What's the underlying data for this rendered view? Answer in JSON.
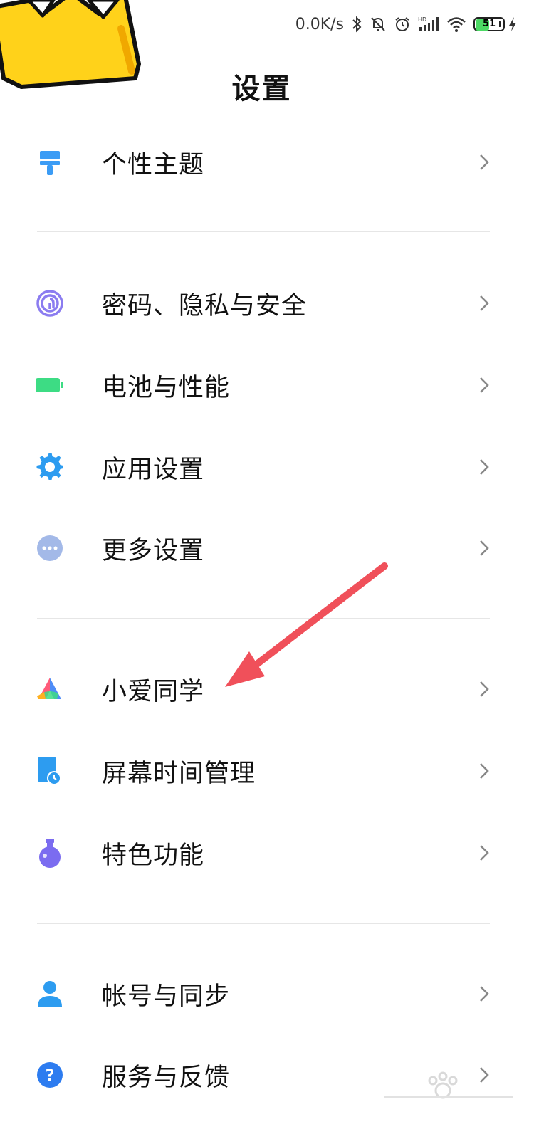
{
  "status_bar": {
    "net_speed": "0.0K/s",
    "battery_level": "51",
    "icons": [
      "bluetooth-icon",
      "mute-icon",
      "alarm-icon",
      "hd-signal-icon",
      "wifi-icon",
      "battery-icon",
      "charging-icon"
    ]
  },
  "header": {
    "title": "设置"
  },
  "settings": {
    "items": [
      {
        "label": "个性主题",
        "icon": "theme-brush-icon",
        "color": "#3b9cf5"
      },
      {
        "label": "密码、隐私与安全",
        "icon": "fingerprint-icon",
        "color": "#8b7cf0"
      },
      {
        "label": "电池与性能",
        "icon": "battery-icon",
        "color": "#3ddc84"
      },
      {
        "label": "应用设置",
        "icon": "gear-icon",
        "color": "#2d9cf0"
      },
      {
        "label": "更多设置",
        "icon": "more-dots-icon",
        "color": "#a3b9e8"
      },
      {
        "label": "小爱同学",
        "icon": "xiaoai-icon",
        "color": "#ff5b7a"
      },
      {
        "label": "屏幕时间管理",
        "icon": "screen-time-icon",
        "color": "#2d9cf0"
      },
      {
        "label": "特色功能",
        "icon": "flask-icon",
        "color": "#7b6cf0"
      },
      {
        "label": "帐号与同步",
        "icon": "account-icon",
        "color": "#2d9cf0"
      },
      {
        "label": "服务与反馈",
        "icon": "help-icon",
        "color": "#2d7cf0"
      }
    ]
  },
  "colors": {
    "annotation_arrow": "#f0505a",
    "crown_fill": "#ffd21a",
    "crown_stroke": "#111111"
  }
}
